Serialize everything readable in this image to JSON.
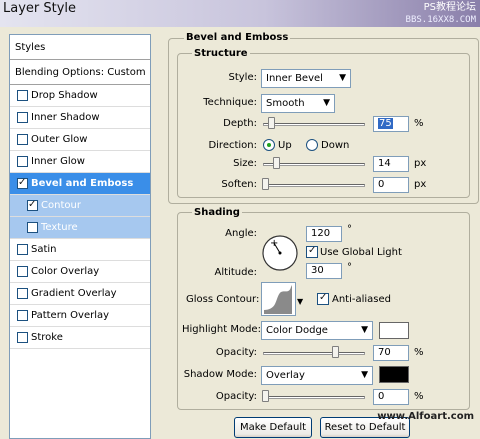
{
  "window": {
    "title": "Layer Style",
    "watermark": "PS教程论坛",
    "watermark_url": "BBS.16XX8.COM"
  },
  "sidebar": {
    "styles_header": "Styles",
    "blending_options": "Blending Options: Custom",
    "items": [
      {
        "label": "Drop Shadow",
        "checked": false
      },
      {
        "label": "Inner Shadow",
        "checked": false
      },
      {
        "label": "Outer Glow",
        "checked": false
      },
      {
        "label": "Inner Glow",
        "checked": false
      },
      {
        "label": "Bevel and Emboss",
        "checked": true,
        "selected": true
      },
      {
        "label": "Contour",
        "checked": true,
        "sub": true
      },
      {
        "label": "Texture",
        "checked": false,
        "sub": true
      },
      {
        "label": "Satin",
        "checked": false
      },
      {
        "label": "Color Overlay",
        "checked": false
      },
      {
        "label": "Gradient Overlay",
        "checked": false
      },
      {
        "label": "Pattern Overlay",
        "checked": false
      },
      {
        "label": "Stroke",
        "checked": false
      }
    ]
  },
  "bevel": {
    "group_title": "Bevel and Emboss",
    "structure_title": "Structure",
    "style_label": "Style:",
    "style_value": "Inner Bevel",
    "technique_label": "Technique:",
    "technique_value": "Smooth",
    "depth_label": "Depth:",
    "depth_value": "75",
    "depth_unit": "%",
    "direction_label": "Direction:",
    "direction_up": "Up",
    "direction_down": "Down",
    "direction_selected": "Up",
    "size_label": "Size:",
    "size_value": "14",
    "size_unit": "px",
    "soften_label": "Soften:",
    "soften_value": "0",
    "soften_unit": "px"
  },
  "shading": {
    "title": "Shading",
    "angle_label": "Angle:",
    "angle_value": "120",
    "angle_unit": "°",
    "use_global_light_label": "Use Global Light",
    "use_global_light": true,
    "altitude_label": "Altitude:",
    "altitude_value": "30",
    "altitude_unit": "°",
    "gloss_contour_label": "Gloss Contour:",
    "anti_aliased_label": "Anti-aliased",
    "anti_aliased": true,
    "highlight_mode_label": "Highlight Mode:",
    "highlight_mode_value": "Color Dodge",
    "highlight_color": "#ffffff",
    "highlight_opacity_label": "Opacity:",
    "highlight_opacity_value": "70",
    "highlight_opacity_unit": "%",
    "shadow_mode_label": "Shadow Mode:",
    "shadow_mode_value": "Overlay",
    "shadow_color": "#000000",
    "shadow_opacity_label": "Opacity:",
    "shadow_opacity_value": "0",
    "shadow_opacity_unit": "%"
  },
  "buttons": {
    "make_default": "Make Default",
    "reset_default": "Reset to Default"
  },
  "footer": {
    "watermark": "www.Alfoart.com"
  },
  "icons": [
    "chevron-down-icon",
    "angle-dial-icon",
    "gloss-contour-icon",
    "checkbox-icon",
    "radio-icon"
  ]
}
